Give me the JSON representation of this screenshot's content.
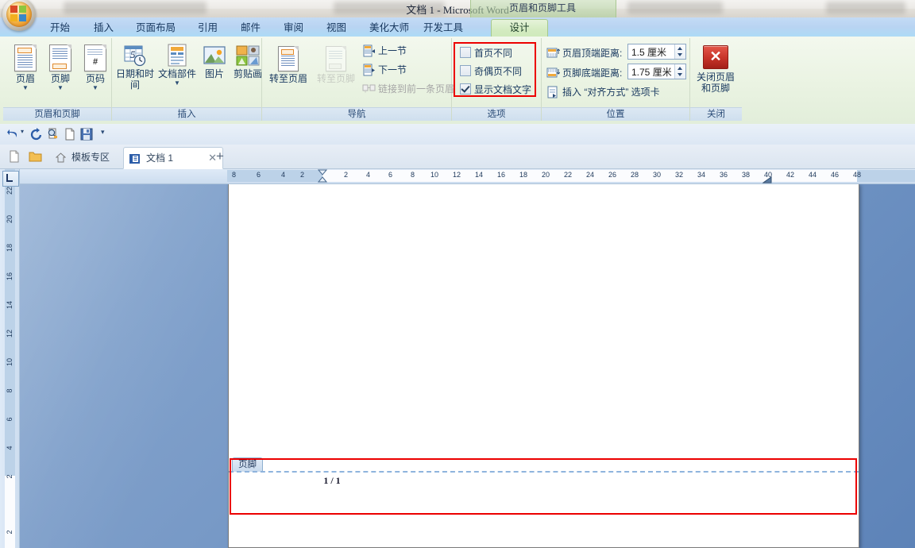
{
  "window": {
    "title": "文档 1 - Microsoft Word",
    "contextual_tools_title": "页眉和页脚工具"
  },
  "ribbon_tabs": [
    {
      "label": "开始",
      "active": false
    },
    {
      "label": "插入",
      "active": false
    },
    {
      "label": "页面布局",
      "active": false
    },
    {
      "label": "引用",
      "active": false
    },
    {
      "label": "邮件",
      "active": false
    },
    {
      "label": "审阅",
      "active": false
    },
    {
      "label": "视图",
      "active": false
    },
    {
      "label": "美化大师",
      "active": false
    },
    {
      "label": "开发工具",
      "active": false
    },
    {
      "label": "设计",
      "active": true
    }
  ],
  "ribbon": {
    "groups": [
      {
        "name": "header-footer",
        "label": "页眉和页脚",
        "buttons": [
          {
            "label": "页眉",
            "icon": "header-page-icon",
            "has_caret": true
          },
          {
            "label": "页脚",
            "icon": "footer-page-icon",
            "has_caret": true
          },
          {
            "label": "页码",
            "icon": "page-number-icon",
            "has_caret": true
          }
        ]
      },
      {
        "name": "insert",
        "label": "插入",
        "buttons": [
          {
            "label": "日期和时间",
            "icon": "date-time-icon",
            "has_caret": false
          },
          {
            "label": "文档部件",
            "icon": "quick-parts-icon",
            "has_caret": true
          },
          {
            "label": "图片",
            "icon": "picture-icon",
            "has_caret": false
          },
          {
            "label": "剪贴画",
            "icon": "clip-art-icon",
            "has_caret": false
          }
        ]
      },
      {
        "name": "navigation",
        "label": "导航",
        "buttons": [
          {
            "label": "转至页眉",
            "icon": "goto-header-icon",
            "disabled": false
          },
          {
            "label": "转至页脚",
            "icon": "goto-footer-icon",
            "disabled": true
          }
        ],
        "rows": [
          {
            "label": "上一节",
            "icon": "previous-section-icon",
            "disabled": false
          },
          {
            "label": "下一节",
            "icon": "next-section-icon",
            "disabled": false
          },
          {
            "label": "链接到前一条页眉",
            "icon": "link-to-previous-icon",
            "disabled": true
          }
        ]
      },
      {
        "name": "options",
        "label": "选项",
        "highlighted": true,
        "checkboxes": [
          {
            "label": "首页不同",
            "checked": false
          },
          {
            "label": "奇偶页不同",
            "checked": false
          },
          {
            "label": "显示文档文字",
            "checked": true
          }
        ]
      },
      {
        "name": "position",
        "label": "位置",
        "fields": [
          {
            "label": "页眉顶端距离:",
            "value": "1.5 厘米",
            "icon": "header-from-top-icon"
          },
          {
            "label": "页脚底端距离:",
            "value": "1.75 厘米",
            "icon": "footer-from-bottom-icon"
          }
        ],
        "rows": [
          {
            "label": "插入 “对齐方式” 选项卡",
            "icon": "insert-alignment-tab-icon"
          }
        ]
      },
      {
        "name": "close",
        "label": "关闭",
        "close_button": {
          "label_line1": "关闭页眉",
          "label_line2": "和页脚",
          "icon": "close-x-icon",
          "glyph": "✕"
        }
      }
    ]
  },
  "quick_access": {
    "items": [
      {
        "name": "undo-icon",
        "glyph": "↰"
      },
      {
        "name": "undo-dropdown-icon",
        "glyph": "▾"
      },
      {
        "name": "redo-icon",
        "glyph": "↻"
      },
      {
        "name": "print-preview-icon",
        "glyph": "🔍"
      },
      {
        "name": "new-document-icon",
        "glyph": "▭"
      },
      {
        "name": "save-icon",
        "glyph": "▣"
      },
      {
        "name": "customize-qat-icon",
        "glyph": "▾"
      }
    ]
  },
  "document_tabs": {
    "left_icons": [
      {
        "name": "new-file-icon",
        "glyph": "▭"
      },
      {
        "name": "open-folder-icon",
        "glyph": "▰"
      }
    ],
    "tabs": [
      {
        "label": "模板专区",
        "icon": "home-icon",
        "active": false,
        "closable": false
      },
      {
        "label": "文档 1",
        "icon": "word-doc-icon",
        "active": true,
        "closable": true
      }
    ],
    "close_glyph": "✕",
    "add_tab_glyph": "+"
  },
  "rulers": {
    "horizontal_ticks": [
      "8",
      "6",
      "4",
      "2",
      "2",
      "4",
      "6",
      "8",
      "10",
      "12",
      "14",
      "16",
      "18",
      "20",
      "22",
      "24",
      "26",
      "28",
      "30",
      "32",
      "34",
      "36",
      "38",
      "40",
      "42",
      "44",
      "46",
      "48"
    ],
    "vertical_ticks": [
      "22",
      "20",
      "18",
      "16",
      "14",
      "12",
      "10",
      "8",
      "6",
      "4",
      "2",
      "2"
    ],
    "tab_stop_selector": "L"
  },
  "document": {
    "footer_tab_label": "页脚",
    "page_number_text": "1 / 1"
  },
  "annotations": {
    "color": "#ec0000",
    "boxes": [
      "options-group",
      "footer-region"
    ]
  },
  "colors": {
    "accent_blue": "#17375e",
    "tab_active_green": "#d3ebc0",
    "annotation_red": "#ec0000",
    "ribbon_bg": "#eaf3e2"
  }
}
